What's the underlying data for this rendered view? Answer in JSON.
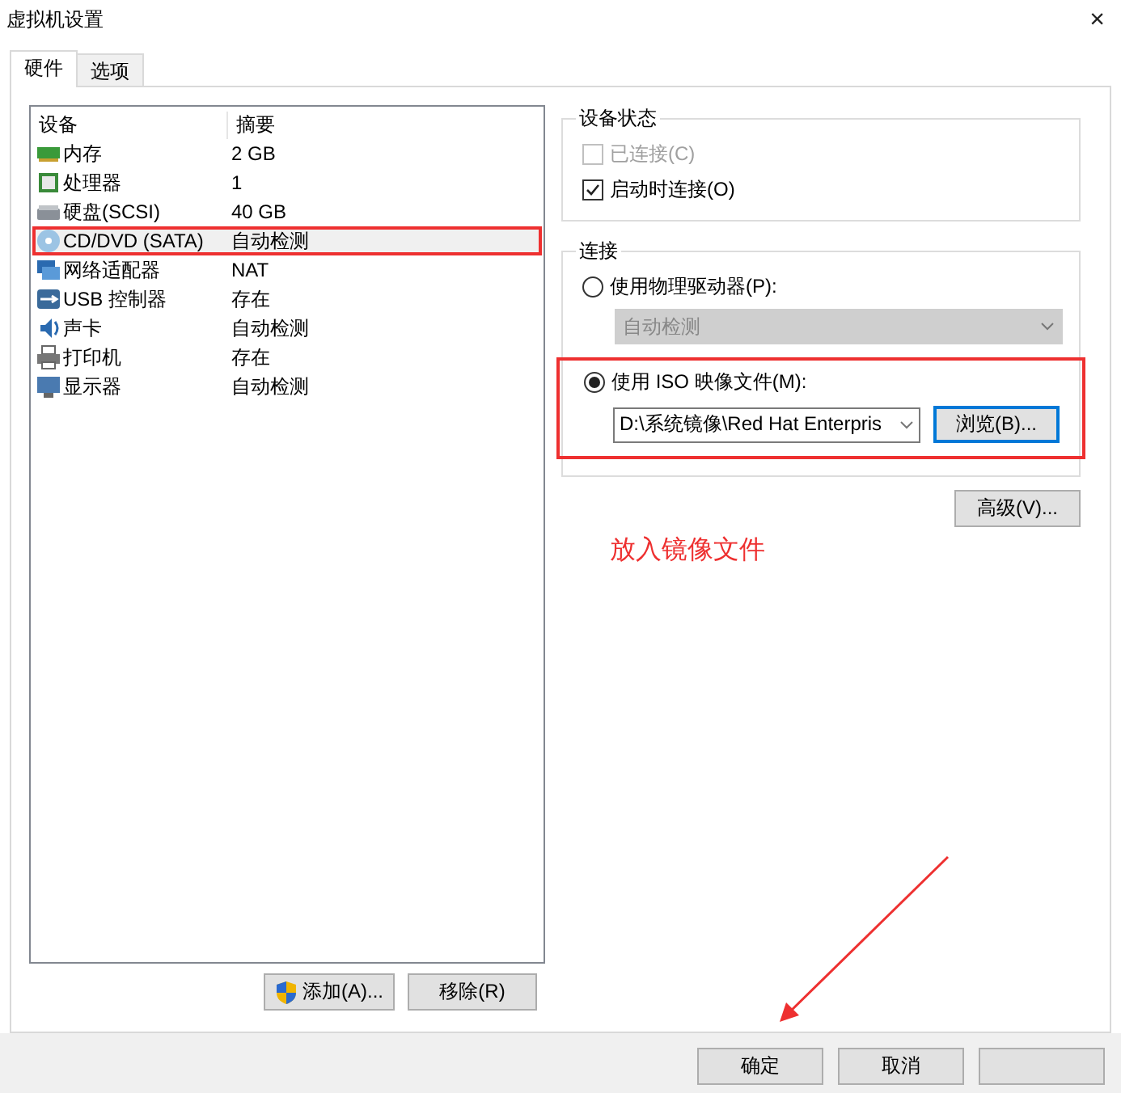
{
  "window": {
    "title": "虚拟机设置",
    "close": "×"
  },
  "tabs": [
    {
      "label": "硬件",
      "selected": true
    },
    {
      "label": "选项",
      "selected": false
    }
  ],
  "devices": {
    "columns": [
      "设备",
      "摘要"
    ],
    "rows": [
      {
        "kind": "memory",
        "name": "内存",
        "summary": "2 GB",
        "selected": false,
        "annotated": false
      },
      {
        "kind": "cpu",
        "name": "处理器",
        "summary": "1",
        "selected": false,
        "annotated": false
      },
      {
        "kind": "disk",
        "name": "硬盘(SCSI)",
        "summary": "40 GB",
        "selected": false,
        "annotated": false
      },
      {
        "kind": "cdrom",
        "name": "CD/DVD (SATA)",
        "summary": "自动检测",
        "selected": true,
        "annotated": true
      },
      {
        "kind": "network",
        "name": "网络适配器",
        "summary": "NAT",
        "selected": false,
        "annotated": false
      },
      {
        "kind": "usb",
        "name": "USB 控制器",
        "summary": "存在",
        "selected": false,
        "annotated": false
      },
      {
        "kind": "sound",
        "name": "声卡",
        "summary": "自动检测",
        "selected": false,
        "annotated": false
      },
      {
        "kind": "printer",
        "name": "打印机",
        "summary": "存在",
        "selected": false,
        "annotated": false
      },
      {
        "kind": "display",
        "name": "显示器",
        "summary": "自动检测",
        "selected": false,
        "annotated": false
      }
    ],
    "buttons": [
      {
        "label": "添加(A)...",
        "shield": true
      },
      {
        "label": "移除(R)",
        "shield": false
      }
    ]
  },
  "device_status": {
    "title": "设备状态",
    "options": [
      {
        "label": "已连接(C)",
        "checked": false,
        "disabled": true
      },
      {
        "label": "启动时连接(O)",
        "checked": true,
        "disabled": false
      }
    ]
  },
  "connection": {
    "title": "连接",
    "physical": {
      "label": "使用物理驱动器(P):",
      "selected": false,
      "drive": {
        "value": "自动检测",
        "disabled": true
      }
    },
    "iso": {
      "label": "使用 ISO 映像文件(M):",
      "selected": true,
      "annotated": true,
      "path": "D:\\系统镜像\\Red Hat Enterpris",
      "browse": "浏览(B)..."
    }
  },
  "advanced_button": "高级(V)...",
  "annotation_text": "放入镜像文件",
  "footer_buttons": [
    "确定",
    "取消"
  ]
}
